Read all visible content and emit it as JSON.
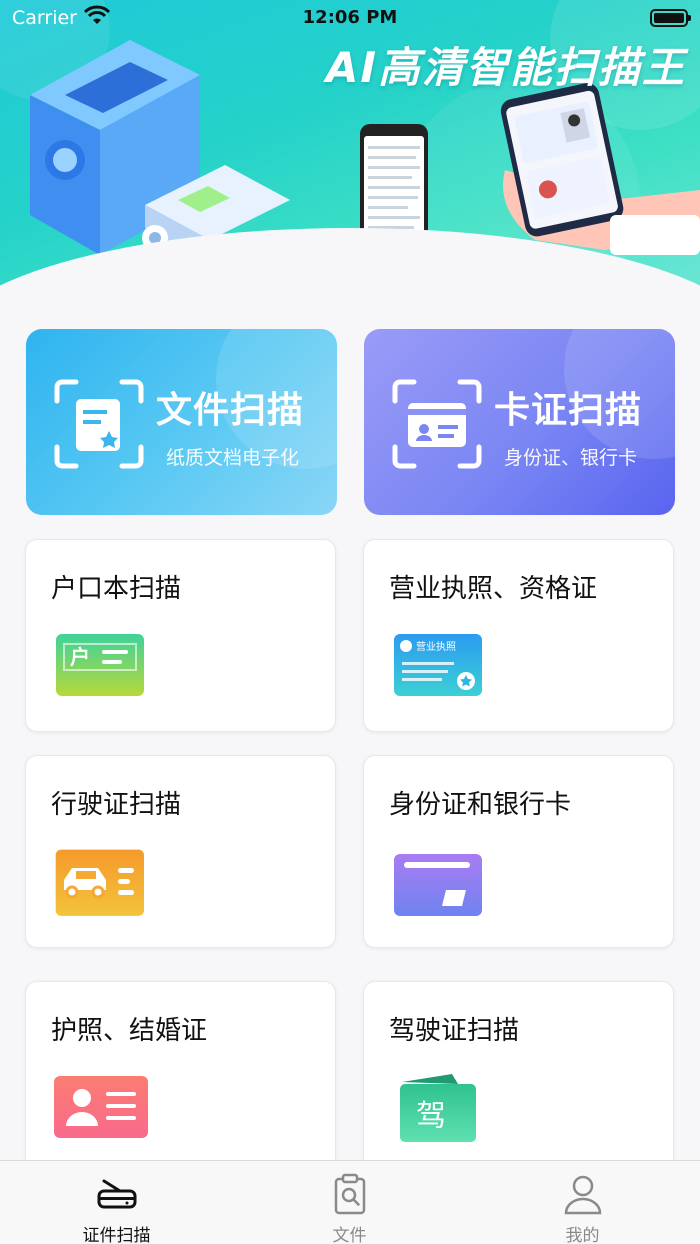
{
  "status_bar": {
    "carrier": "Carrier",
    "time": "12:06 PM"
  },
  "banner": {
    "headline": "AI高清智能扫描王"
  },
  "feature_cards": [
    {
      "title": "文件扫描",
      "subtitle": "纸质文档电子化",
      "icon": "document-star-icon"
    },
    {
      "title": "卡证扫描",
      "subtitle": "身份证、银行卡",
      "icon": "id-card-icon"
    }
  ],
  "scan_types": [
    {
      "label": "户口本扫描",
      "icon": "household-register-icon",
      "icon_text": "户"
    },
    {
      "label": "营业执照、资格证",
      "icon": "business-license-icon",
      "icon_text": "营业执照"
    },
    {
      "label": "行驶证扫描",
      "icon": "car-license-icon"
    },
    {
      "label": "身份证和银行卡",
      "icon": "bank-card-icon"
    },
    {
      "label": "护照、结婚证",
      "icon": "passport-icon"
    },
    {
      "label": "驾驶证扫描",
      "icon": "driver-license-icon",
      "icon_text": "驾"
    }
  ],
  "tabs": [
    {
      "label": "证件扫描",
      "icon": "scanner-icon",
      "active": true
    },
    {
      "label": "文件",
      "icon": "clipboard-search-icon",
      "active": false
    },
    {
      "label": "我的",
      "icon": "person-icon",
      "active": false
    }
  ],
  "colors": {
    "banner": "#25d2c9",
    "doc_card": "#2fb4ef",
    "card_card": "#6f7cf2",
    "tab_active": "#111111",
    "tab_inactive": "#8a8a8a"
  }
}
